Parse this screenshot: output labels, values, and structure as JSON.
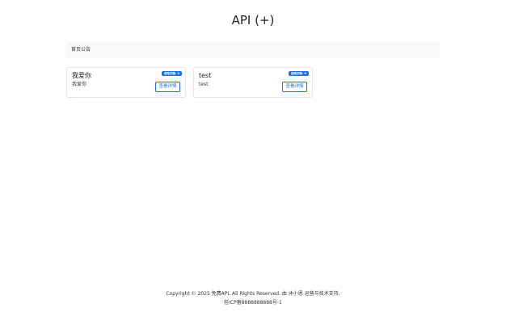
{
  "header": {
    "title": "API (+)"
  },
  "notice": {
    "label": "首页公告"
  },
  "cards": [
    {
      "title": "我爱你",
      "description": "我爱你",
      "badge": "使用次数: 0",
      "button_label": "查看详情"
    },
    {
      "title": "test",
      "description": "test",
      "badge": "使用次数: 0",
      "button_label": "查看详情"
    }
  ],
  "footer": {
    "copyright": "Copyright © 2025 免费API, All Rights Reserved. 由 沐小恩 运营与技术支持.",
    "icp": "桂ICP备8888888888号-1"
  },
  "colors": {
    "accent": "#1e6fd9",
    "notice_bg": "#f7f8fa",
    "card_border": "#e3e6ea"
  }
}
